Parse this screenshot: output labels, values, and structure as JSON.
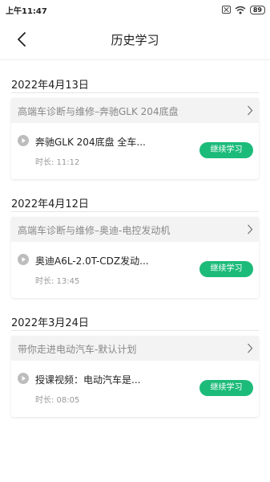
{
  "status_bar": {
    "time": "上午11:47",
    "icons": [
      "sim-off-icon",
      "wifi-icon",
      "battery-icon"
    ],
    "battery": "89"
  },
  "header": {
    "back_icon": "chevron-left-icon",
    "title": "历史学习"
  },
  "colors": {
    "accent": "#1dbb7a",
    "course_header_bg": "#f3f3f3",
    "muted_text": "#999999"
  },
  "groups": [
    {
      "date": "2022年4月13日",
      "course": "高端车诊断与维修–奔驰GLK 204底盘",
      "lesson": "奔驰GLK 204底盘 全车...",
      "duration": "时长: 11:12",
      "action": "继续学习"
    },
    {
      "date": "2022年4月12日",
      "course": "高端车诊断与维修–奥迪-电控发动机",
      "lesson": "奥迪A6L-2.0T-CDZ发动...",
      "duration": "时长: 13:45",
      "action": "继续学习"
    },
    {
      "date": "2022年3月24日",
      "course": "带你走进电动汽车-默认计划",
      "lesson": "授课视频：电动汽车是...",
      "duration": "时长: 08:05",
      "action": "继续学习"
    }
  ]
}
